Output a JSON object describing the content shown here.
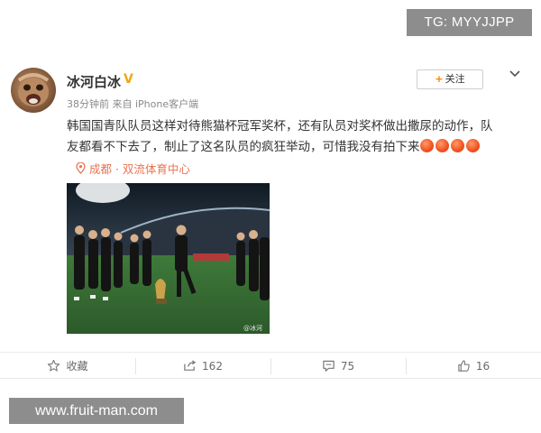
{
  "watermarks": {
    "top": "TG: MYYJJPP",
    "bottom": "www.fruit-man.com"
  },
  "post": {
    "author": "冰河白冰",
    "vip_badge": "V",
    "time": "38分钟前",
    "source": "来自 iPhone客户端",
    "follow_label": "关注",
    "text_line1": "韩国国青队队员这样对待熊猫杯冠军奖杯，还有队员对奖杯做出撒尿的动作，队",
    "text_line2": "友都看不下去了，制止了这名队员的疯狂举动，可惜我没有拍下来",
    "location": "成都 · 双流体育中心",
    "photo_watermark": "@冰河"
  },
  "actions": {
    "favorite": "收藏",
    "repost_count": "162",
    "comment_count": "75",
    "like_count": "16"
  },
  "icons": [
    "vip-badge-icon",
    "more-chevron-icon",
    "location-pin-icon",
    "star-icon",
    "repost-icon",
    "comment-icon",
    "thumb-up-icon",
    "angry-emoji-icon"
  ]
}
